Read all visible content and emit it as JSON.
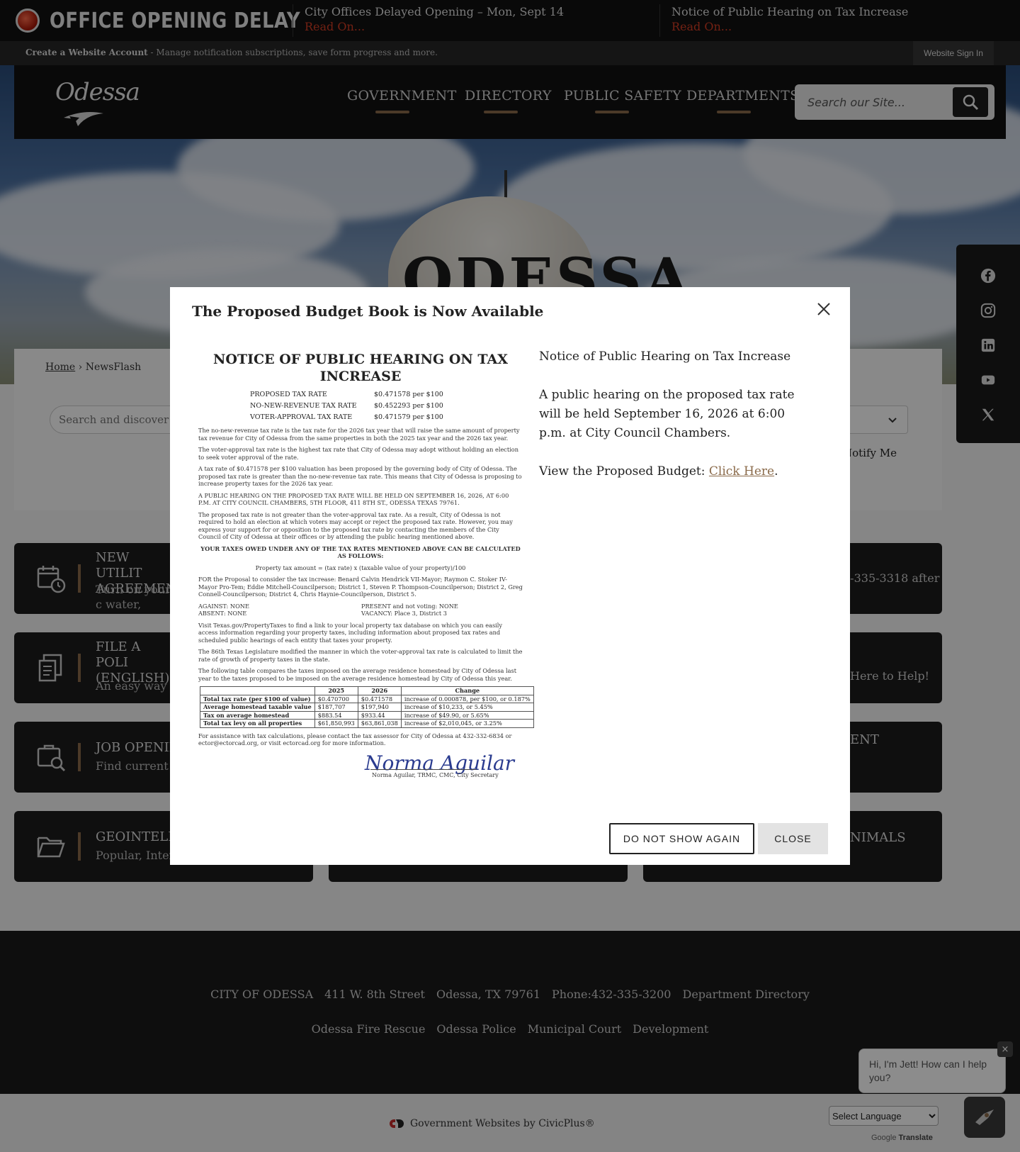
{
  "alert": {
    "title": "OFFICE OPENING DELAY",
    "items": [
      {
        "title": "City Offices Delayed Opening – Mon, Sept 14",
        "link": "Read On..."
      },
      {
        "title": "Notice of Public Hearing on Tax Increase",
        "link": "Read On..."
      }
    ]
  },
  "account": {
    "create_label": "Create a Website Account",
    "create_desc": " - Manage notification subscriptions, save form progress and more.",
    "sign_in": "Website Sign In"
  },
  "header": {
    "logo_text": "Odessa",
    "nav": [
      "GOVERNMENT",
      "DIRECTORY",
      "PUBLIC SAFETY",
      "DEPARTMENTS"
    ],
    "search_placeholder": "Search our Site..."
  },
  "hero": {
    "tower_text": "ODESSA"
  },
  "social": [
    "facebook-icon",
    "instagram-icon",
    "linkedin-icon",
    "youtube-icon",
    "x-icon"
  ],
  "content": {
    "breadcrumb_home": "Home",
    "breadcrumb_sep": " › ",
    "breadcrumb_current": "NewsFlash",
    "search_placeholder": "Search and discover",
    "notify": "Notify Me"
  },
  "tiles": [
    {
      "title": "NEW UTILIT AGREEMEN",
      "desc": "Turn on your c water, sewer an"
    },
    {
      "title": "FILE A POLI (ENGLISH)",
      "desc": "An easy way to"
    },
    {
      "title": "JOB OPENIN",
      "desc": "Find current jo"
    },
    {
      "title": "GEOINTELL",
      "desc": "Popular, Intera"
    }
  ],
  "tiles_right": [
    "2-335-3318 after",
    "Here to Help!",
    "ENT",
    "NIMALS"
  ],
  "footer": {
    "row1": [
      "CITY OF ODESSA",
      "411 W. 8th Street",
      "Odessa, TX 79761",
      "Phone:432-335-3200",
      "Department Directory"
    ],
    "row2": [
      "Odessa Fire Rescue",
      "Odessa Police",
      "Municipal Court",
      "Development"
    ],
    "civicplus": "Government Websites by CivicPlus®",
    "language": "Select Language",
    "translate_google": "Google",
    "translate_label": "Translate"
  },
  "chat": {
    "greeting": "Hi, I'm Jett! How can I help you?",
    "close": "×"
  },
  "modal": {
    "title": "The Proposed Budget Book is Now Available",
    "notice_heading": "Notice of Public Hearing on Tax Increase",
    "notice_body": "A public hearing on the proposed tax rate will be held September 16, 2026 at 6:00 p.m. at City Council Chambers.",
    "budget_prefix": "View the Proposed Budget: ",
    "budget_link": "Click Here",
    "budget_suffix": ".",
    "btn_dont_show": "DO NOT SHOW AGAIN",
    "btn_close": "CLOSE"
  },
  "notice_doc": {
    "title": "NOTICE OF PUBLIC HEARING ON TAX INCREASE",
    "rates": [
      {
        "label": "PROPOSED TAX RATE",
        "value": "$0.471578 per $100"
      },
      {
        "label": "NO-NEW-REVENUE TAX RATE",
        "value": "$0.452293 per $100"
      },
      {
        "label": "VOTER-APPROVAL TAX RATE",
        "value": "$0.471579  per $100"
      }
    ],
    "p1": "The no-new-revenue tax rate is the tax rate for the 2026 tax year that will raise the same amount of property tax revenue for City of Odessa from the same properties in both the 2025 tax year and the 2026 tax year.",
    "p2": "The voter-approval tax rate is the highest tax rate that City of Odessa may adopt without holding an election to seek voter approval of the rate.",
    "p3": "A tax rate of $0.471578 per $100 valuation has been proposed by the governing body of City of Odessa. The proposed tax rate is greater than the no-new-revenue tax rate. This means that City of Odessa is proposing to increase property taxes for the 2026 tax year.",
    "p4": "A PUBLIC HEARING ON THE PROPOSED TAX RATE WILL BE HELD ON SEPTEMBER 16, 2026, AT 6:00 P.M. AT CITY COUNCIL CHAMBERS, 5TH FLOOR, 411 8TH ST., ODESSA TEXAS 79761.",
    "p5": "The proposed tax rate is not greater than the voter-approval tax rate. As a result, City of Odessa is not required to hold an election at which voters may accept or reject the proposed tax rate. However, you may express your support for or opposition to the proposed tax rate by contacting the members of the City Council of City of Odessa at their offices or by attending the public hearing mentioned above.",
    "p6": "YOUR TAXES OWED UNDER ANY OF THE TAX RATES MENTIONED ABOVE CAN BE CALCULATED AS FOLLOWS:",
    "p7": "Property tax amount = (tax rate) x (taxable value of your property)/100",
    "p8": "FOR the Proposal to consider the tax increase: Benard Calvin Hendrick VII-Mayor; Raymon C. Stoker IV-Mayor Pro-Tem; Eddie Mitchell-Councilperson; District 1, Steven P. Thompson-Councilperson; District 2, Greg Connell-Councilperson; District 4, Chris Haynie-Councilperson, District 5.",
    "against": "AGAINST:  NONE",
    "present": "PRESENT and not voting:  NONE",
    "absent": "ABSENT:   NONE",
    "vacancy": "VACANCY: Place 3, District 3",
    "p9": "Visit Texas.gov/PropertyTaxes to find a link to your local property tax database on which you can easily access information regarding your property taxes, including information about proposed tax rates and scheduled public hearings of each entity that taxes your property.",
    "p10": "The 86th Texas Legislature modified the manner in which the voter-approval tax rate is calculated to limit the rate of growth of property taxes in the state.",
    "p11": "The following table compares the taxes imposed on the average residence homestead by City of Odessa last year to the taxes proposed to be imposed on the average residence homestead by City of Odessa this year.",
    "table_head": [
      "",
      "2025",
      "2026",
      "Change"
    ],
    "table_rows": [
      [
        "Total tax rate (per $100 of value)",
        "$0.470700",
        "$0.471578",
        "increase of 0.000878, per $100, or 0.187%"
      ],
      [
        "Average homestead taxable value",
        "$187,707",
        "$197,940",
        "increase of $10,233, or 5.45%"
      ],
      [
        "Tax on average homestead",
        "$883.54",
        "$933.44",
        "increase of $49.90, or 5.65%"
      ],
      [
        "Total tax levy on all properties",
        "$61,850,993",
        "$63,861,038",
        "increase of $2,010,045, or 3.25%"
      ]
    ],
    "p12": "For assistance with tax calculations, please contact the tax assessor for City of Odessa at 432-332-6834 or ector@ectorcad.org, or visit ectorcad.org for more information.",
    "signature": "Norma Aguilar",
    "signature_caption": "Norma Aguilar, TRMC, CMC, City Secretary"
  }
}
